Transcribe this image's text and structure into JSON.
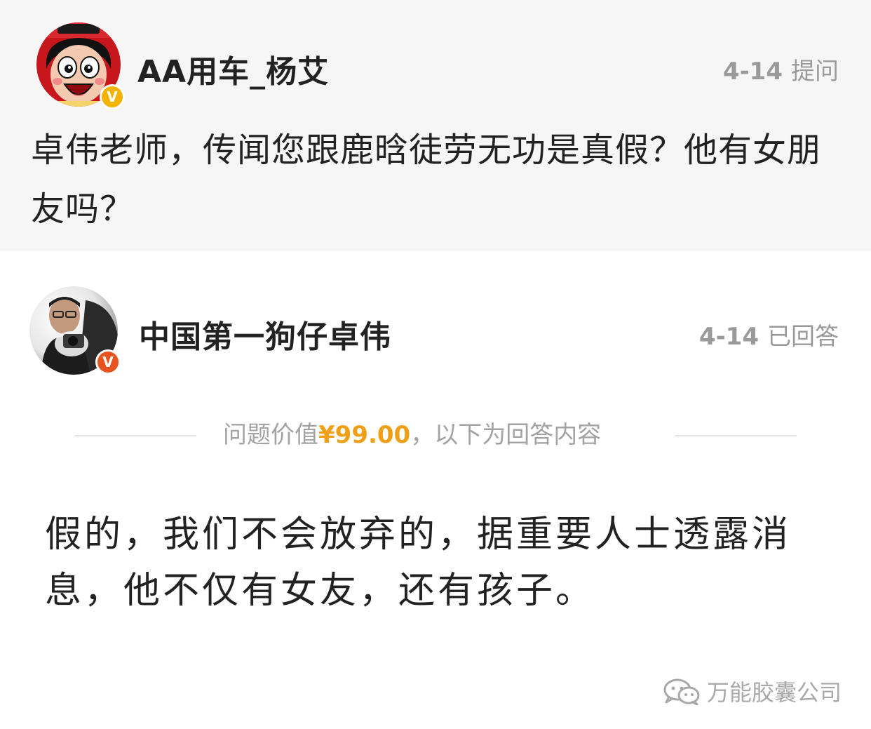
{
  "question": {
    "user_name": "AA用车_杨艾",
    "date": "4-14",
    "action": "提问",
    "text": "卓伟老师，传闻您跟鹿晗徒劳无功是真假？他有女朋友吗？",
    "badge_color": "#f5b301"
  },
  "answerer": {
    "user_name": "中国第一狗仔卓伟",
    "date": "4-14",
    "action": "已回答",
    "badge_color": "#e8541f"
  },
  "divider": {
    "prefix": "问题价值",
    "price": "¥99.00",
    "suffix": "，以下为回答内容",
    "price_color": "#f0a017"
  },
  "answer": {
    "text": "假的，我们不会放弃的，据重要人士透露消息，他不仅有女友，还有孩子。"
  },
  "verified_badge_symbol": "V",
  "watermark": {
    "icon": "wechat-icon",
    "text": "万能胶囊公司"
  }
}
